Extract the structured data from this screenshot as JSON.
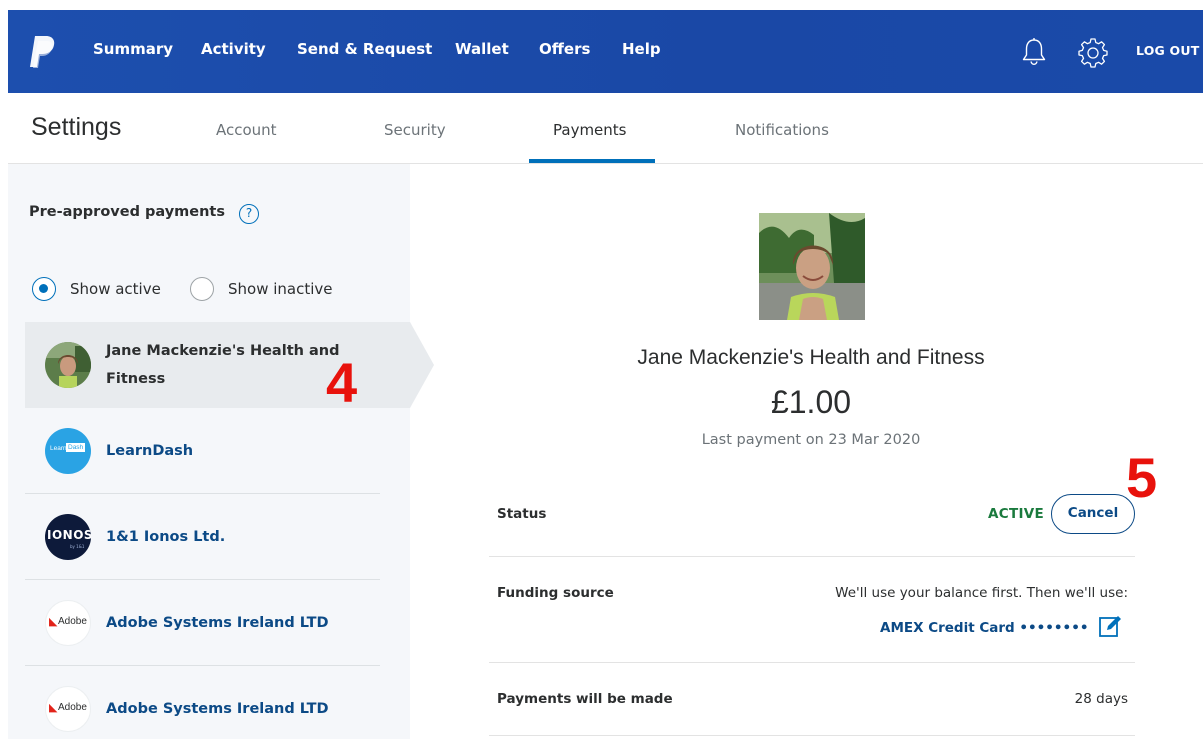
{
  "nav": {
    "items": [
      {
        "label": "Summary"
      },
      {
        "label": "Activity"
      },
      {
        "label": "Send & Request"
      },
      {
        "label": "Wallet"
      },
      {
        "label": "Offers"
      },
      {
        "label": "Help"
      }
    ],
    "notifications_icon": "bell-icon",
    "settings_icon": "gear-icon",
    "logout_label": "LOG OUT",
    "brand_color": "#1b4aa8"
  },
  "settings": {
    "title": "Settings",
    "tabs": [
      {
        "label": "Account"
      },
      {
        "label": "Security"
      },
      {
        "label": "Payments",
        "active": true
      },
      {
        "label": "Notifications"
      }
    ]
  },
  "preapproved": {
    "title": "Pre-approved payments",
    "help_icon": "?",
    "filters": {
      "active": "Show active",
      "inactive": "Show inactive",
      "selected": "active"
    },
    "merchants": [
      {
        "name_line1": "Jane Mackenzie's Health and",
        "name_line2": "Fitness",
        "selected": true
      },
      {
        "name": "LearnDash",
        "logo_text_a": "Learn",
        "logo_text_b": "Dash"
      },
      {
        "name": "1&1 Ionos Ltd.",
        "logo_text": "IONOS",
        "logo_sub": "by 1&1"
      },
      {
        "name": "Adobe Systems Ireland LTD",
        "logo_text": "Adobe"
      },
      {
        "name": "Adobe Systems Ireland LTD",
        "logo_text": "Adobe"
      }
    ]
  },
  "annotations": {
    "left": "4",
    "right": "5",
    "color": "#e8120c"
  },
  "detail": {
    "name": "Jane Mackenzie's Health and Fitness",
    "amount": "£1.00",
    "last_payment": "Last payment on 23 Mar 2020",
    "status_label": "Status",
    "status_value": "ACTIVE",
    "cancel_label": "Cancel",
    "funding_label": "Funding source",
    "funding_note": "We'll use your balance first. Then we'll use:",
    "funding_card": "AMEX Credit Card ••••••••",
    "frequency_label": "Payments will be made",
    "frequency_value": "28 days"
  }
}
